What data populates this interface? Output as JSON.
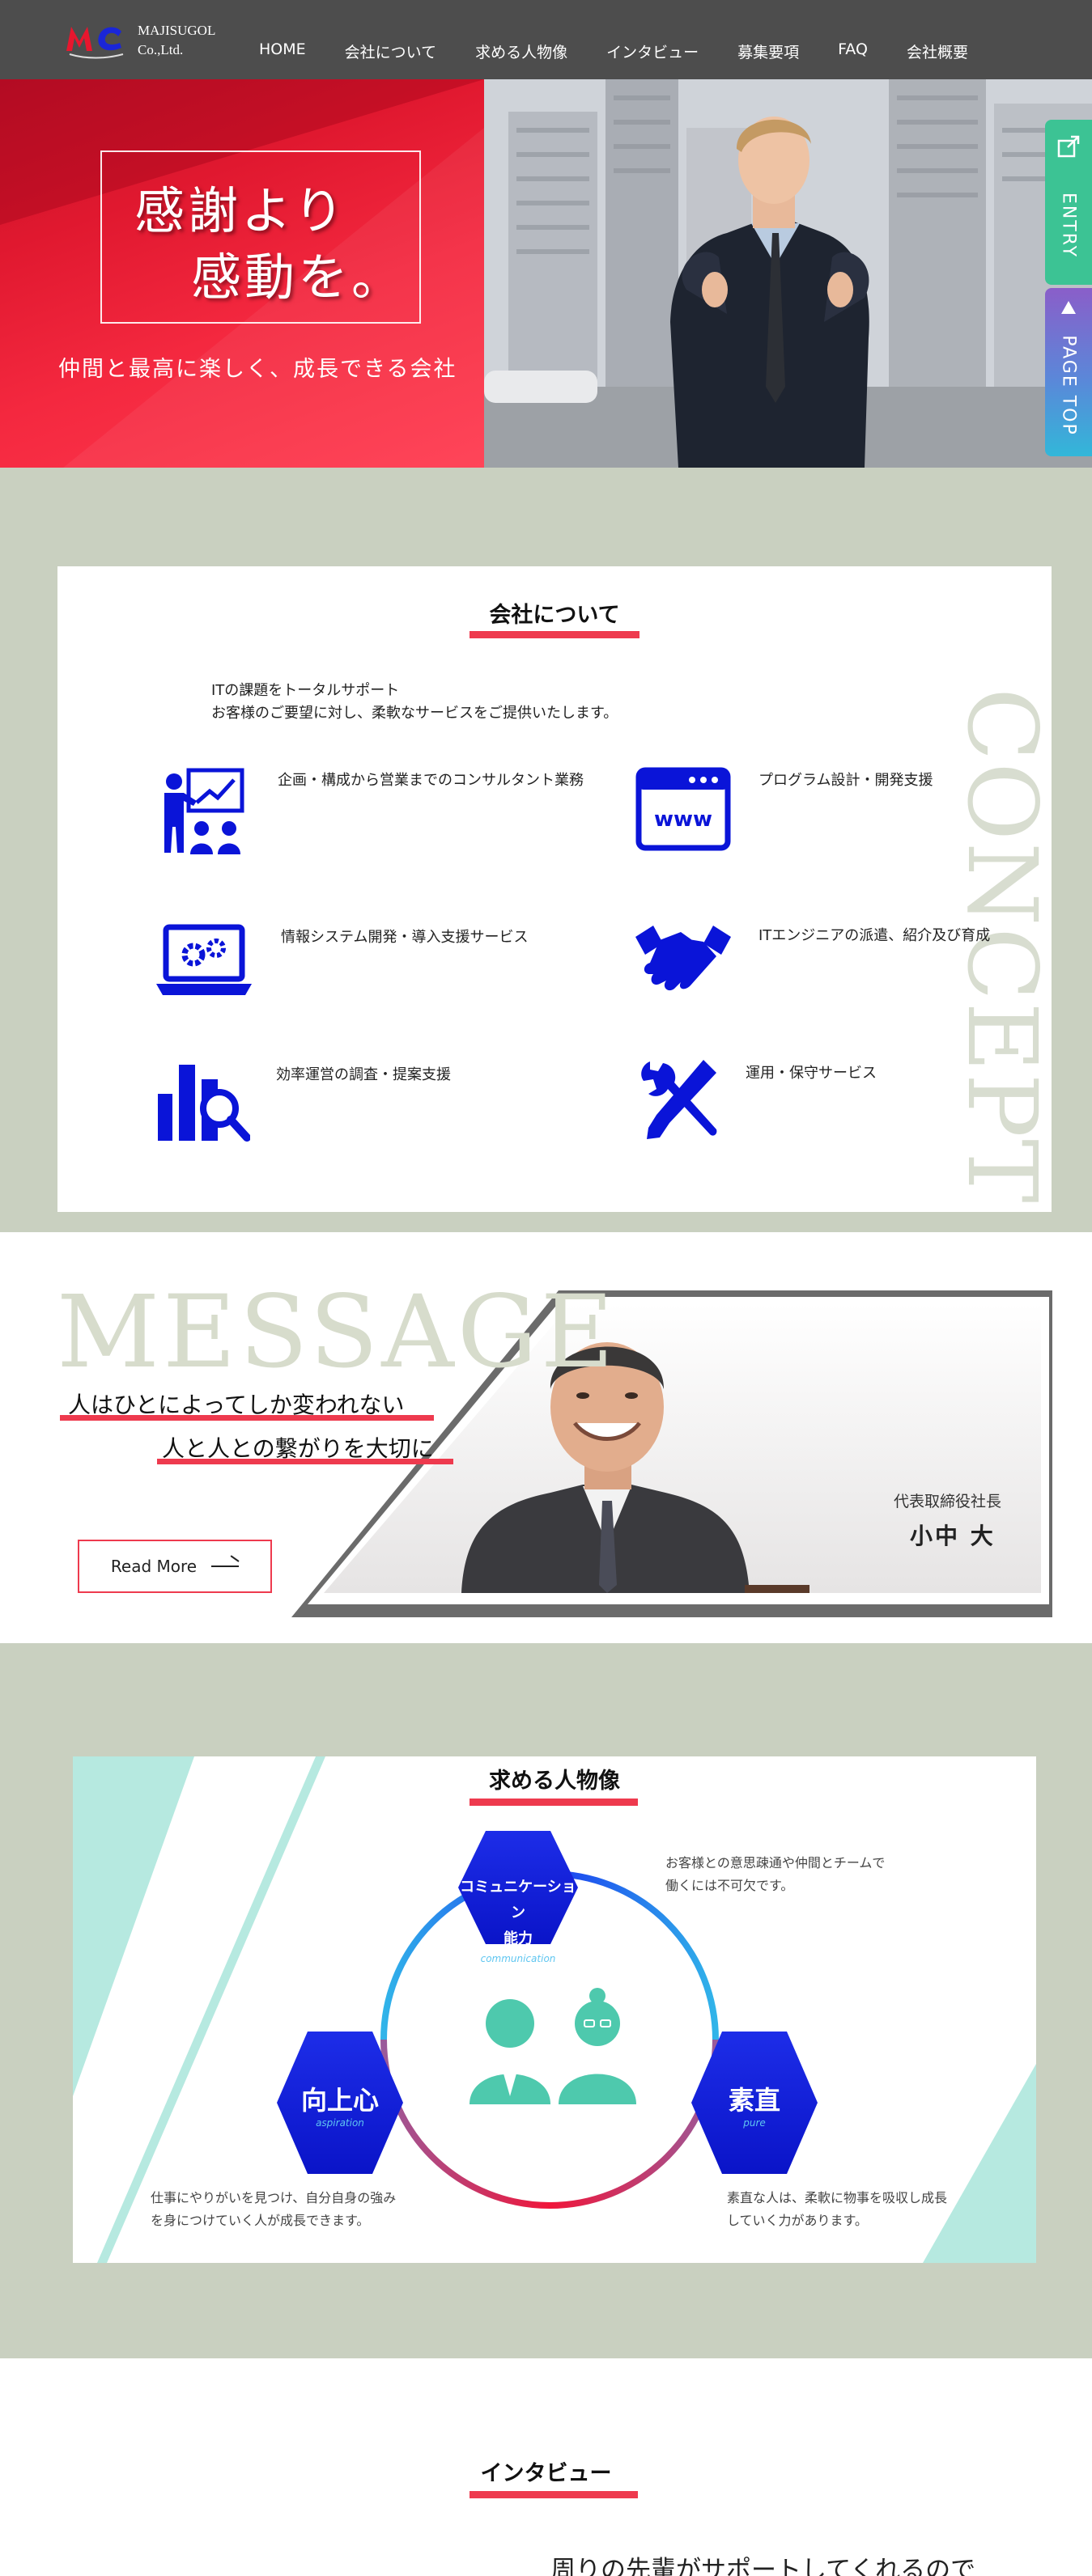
{
  "header": {
    "logo_line1": "MAJISUGOL",
    "logo_line2": "Co.,Ltd.",
    "nav": [
      "HOME",
      "会社について",
      "求める人物像",
      "インタビュー",
      "募集要項",
      "FAQ",
      "会社概要"
    ]
  },
  "hero": {
    "title_line1": "感謝より",
    "title_line2": "感動を。",
    "subtitle": "仲間と最高に楽しく、成長できる会社"
  },
  "side_tabs": {
    "entry": "ENTRY",
    "page_top": "PAGE TOP"
  },
  "concept": {
    "title": "会社について",
    "intro_line1": "ITの課題をトータルサポート",
    "intro_line2": "お客様のご要望に対し、柔軟なサービスをご提供いたします。",
    "vertical_text": "CONCEPT",
    "services": [
      {
        "icon": "consultant-icon",
        "label": "企画・構成から営業までのコンサルタント業務"
      },
      {
        "icon": "www-icon",
        "label": "プログラム設計・開発支援"
      },
      {
        "icon": "laptop-gear-icon",
        "label": "情報システム開発・導入支援サービス"
      },
      {
        "icon": "handshake-icon",
        "label": "ITエンジニアの派遣、紹介及び育成"
      },
      {
        "icon": "chart-search-icon",
        "label": "効率運営の調査・提案支援"
      },
      {
        "icon": "tools-icon",
        "label": "運用・保守サービス"
      }
    ]
  },
  "message": {
    "big_text": "MESSAGE",
    "line1": "人はひとによってしか変われない",
    "line2": "人と人との繋がりを大切に",
    "read_more": "Read More",
    "ceo_role": "代表取締役社長",
    "ceo_name": "小中 大"
  },
  "talent": {
    "title": "求める人物像",
    "hex_top_line1": "コミュニケーション",
    "hex_top_line2": "能力",
    "hex_top_en": "communication",
    "hex_left": "向上心",
    "hex_left_en": "aspiration",
    "hex_right": "素直",
    "hex_right_en": "pure",
    "desc_top_line1": "お客様との意思疎通や仲間とチームで",
    "desc_top_line2": "働くには不可欠です。",
    "desc_left_line1": "仕事にやりがいを見つけ、自分自身の強み",
    "desc_left_line2": "を身につけていく人が成長できます。",
    "desc_right_line1": "素直な人は、柔軟に物事を吸収し成長",
    "desc_right_line2": "していく力があります。"
  },
  "interview": {
    "title": "インタビュー",
    "teaser": "周りの先輩がサポートしてくれるので"
  },
  "colors": {
    "accent_red": "#ee3a4e",
    "icon_blue": "#0a14d8",
    "sage": "#c9d0c0",
    "entry_green": "#3cc394"
  }
}
